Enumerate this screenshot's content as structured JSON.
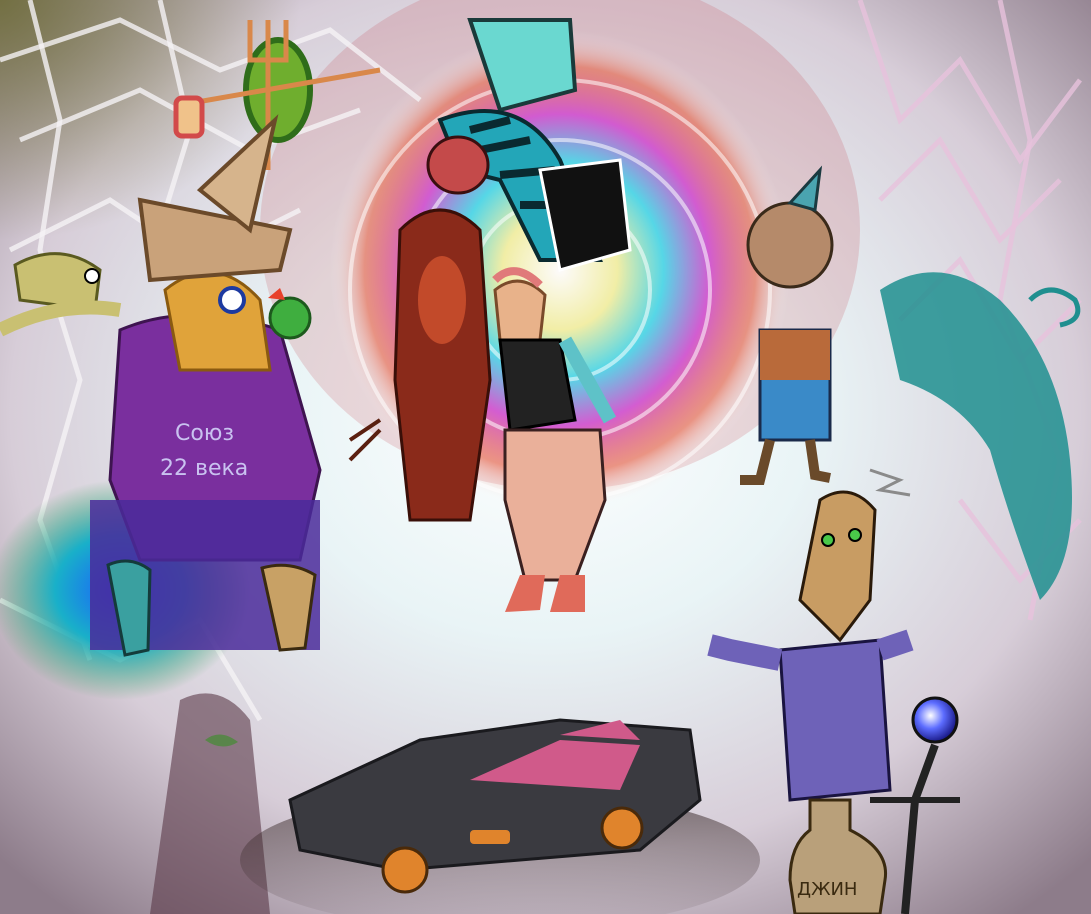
{
  "artwork": {
    "sweater_text": [
      "Союз",
      "22 века"
    ],
    "bottle_label": "ДЖИН",
    "palette": {
      "background": "#e6dfe6",
      "swirl_cyan": "#42d6e8",
      "swirl_magenta": "#c03fcf",
      "web_lines": "#f2eef2",
      "sweater_purple": "#7a2f9e",
      "car_body": "#3a3a40",
      "car_window": "#d05a8a",
      "car_wheel": "#e0842c",
      "genie_shirt": "#6e62b8",
      "skin": "#c49a63",
      "teal_creature": "#1f8f8f"
    }
  }
}
